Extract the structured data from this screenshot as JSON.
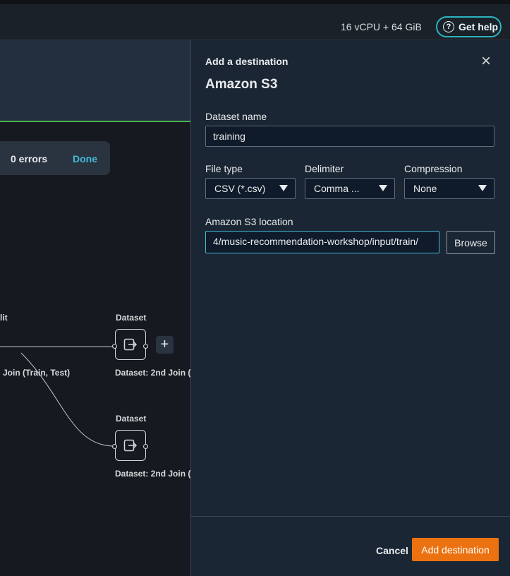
{
  "topbar": {
    "resources": "16 vCPU + 64 GiB",
    "help_label": "Get help",
    "help_icon": "?"
  },
  "canvas": {
    "status": {
      "errors": "0 errors",
      "done": "Done"
    },
    "edge_label_split_cut": "lit",
    "edge_label_join": "Join (Train, Test)",
    "nodes": [
      {
        "header": "Dataset",
        "caption": "Dataset: 2nd Join (T"
      },
      {
        "header": "Dataset",
        "caption": "Dataset: 2nd Join (T"
      }
    ],
    "add_step_label": "+"
  },
  "panel": {
    "subtitle": "Add a destination",
    "title": "Amazon S3",
    "close_icon": "×",
    "dataset_name": {
      "label": "Dataset name",
      "value": "training"
    },
    "file_type": {
      "label": "File type",
      "value": "CSV (*.csv)"
    },
    "delimiter": {
      "label": "Delimiter",
      "value": "Comma ..."
    },
    "compression": {
      "label": "Compression",
      "value": "None"
    },
    "s3_location": {
      "label": "Amazon S3 location",
      "value": "4/music-recommendation-workshop/input/train/"
    },
    "browse_label": "Browse",
    "cancel_label": "Cancel",
    "add_label": "Add destination"
  },
  "colors": {
    "accent": "#ec7211",
    "link": "#44b9d6",
    "focus": "#2bb3c0",
    "success": "#4caf50"
  }
}
